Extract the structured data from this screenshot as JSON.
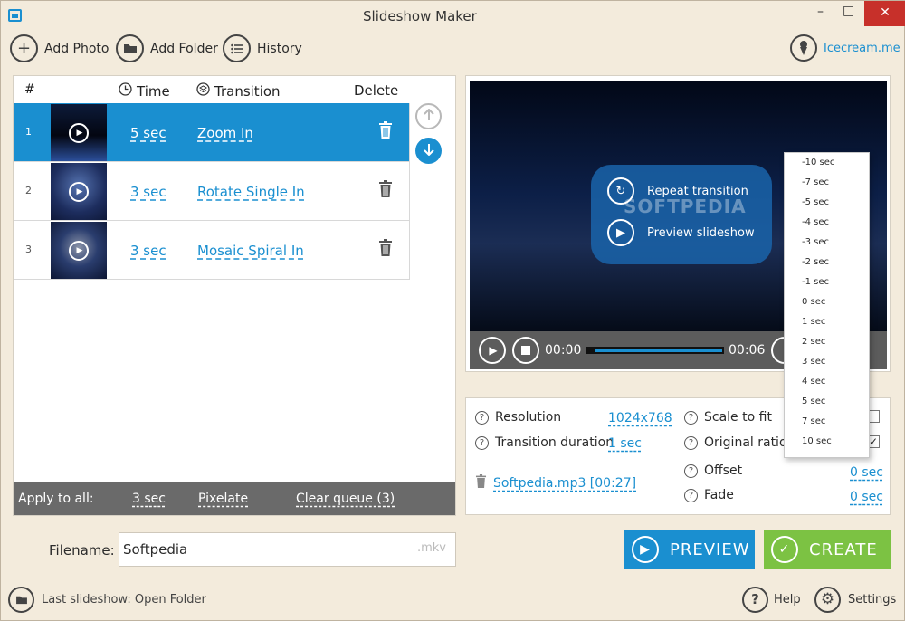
{
  "window": {
    "title": "Slideshow Maker",
    "controls": [
      "–",
      "□",
      "✕"
    ]
  },
  "toolbar": {
    "add_photo": "Add Photo",
    "add_folder": "Add Folder",
    "history": "History",
    "brand_link": "Icecream.me"
  },
  "queue": {
    "headers": {
      "num": "#",
      "time": "Time",
      "transition": "Transition",
      "delete": "Delete"
    },
    "rows": [
      {
        "num": "1",
        "time": "5 sec",
        "transition": "Zoom In",
        "selected": true
      },
      {
        "num": "2",
        "time": "3 sec",
        "transition": "Rotate Single In",
        "selected": false
      },
      {
        "num": "3",
        "time": "3 sec",
        "transition": "Mosaic Spiral In",
        "selected": false
      }
    ],
    "apply_all": {
      "label": "Apply to all:",
      "time": "3 sec",
      "transition": "Pixelate",
      "clear": "Clear queue (3)"
    }
  },
  "preview": {
    "overlay": {
      "repeat": "Repeat transition",
      "preview": "Preview slideshow"
    },
    "watermark": "SOFTPEDIA",
    "time_current": "00:00",
    "time_total": "00:06"
  },
  "settings": {
    "resolution_label": "Resolution",
    "resolution_value": "1024x768",
    "transition_duration_label": "Transition duration",
    "transition_duration_value": "1 sec",
    "audio_file": "Softpedia.mp3 [00:27]",
    "scale_to_fit_label": "Scale to fit",
    "original_ratio_label": "Original ratio",
    "offset_label": "Offset",
    "offset_value": "0 sec",
    "fade_label": "Fade",
    "fade_value": "0 sec"
  },
  "offset_dropdown": {
    "options": [
      "-10 sec",
      "-7 sec",
      "-5 sec",
      "-4 sec",
      "-3 sec",
      "-2 sec",
      "-1 sec",
      "0 sec",
      "1 sec",
      "2 sec",
      "3 sec",
      "4 sec",
      "5 sec",
      "7 sec",
      "10 sec"
    ]
  },
  "output": {
    "filename_label": "Filename:",
    "filename_value": "Softpedia",
    "extension": ".mkv",
    "preview_button": "PREVIEW",
    "create_button": "CREATE"
  },
  "footer": {
    "last_slideshow": "Last slideshow: Open Folder",
    "help": "Help",
    "settings": "Settings"
  },
  "colors": {
    "accent_blue": "#1a8fd0",
    "create_green": "#7cc243",
    "background": "#f3ebdc"
  }
}
